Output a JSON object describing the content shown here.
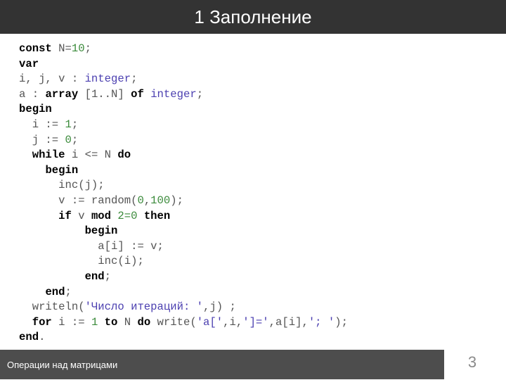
{
  "slide": {
    "title": "1 Заполнение",
    "footer": "Операции над матрицами",
    "page_number": "3"
  },
  "colors": {
    "title_bar": "#333333",
    "footer_bar": "#4d4d4d",
    "keyword": "#000000",
    "number": "#3a8a3a",
    "type_and_string": "#4b3fb0",
    "identifier": "#555555"
  },
  "code": {
    "language": "Pascal",
    "lines": [
      [
        {
          "t": "const",
          "c": "kw"
        },
        {
          "t": " N=",
          "c": ""
        },
        {
          "t": "10",
          "c": "num"
        },
        {
          "t": ";",
          "c": ""
        }
      ],
      [
        {
          "t": "var",
          "c": "kw"
        }
      ],
      [
        {
          "t": "i, j, v : ",
          "c": ""
        },
        {
          "t": "integer",
          "c": "type"
        },
        {
          "t": ";",
          "c": ""
        }
      ],
      [
        {
          "t": "a : ",
          "c": ""
        },
        {
          "t": "array",
          "c": "kw"
        },
        {
          "t": " [1..N] ",
          "c": ""
        },
        {
          "t": "of",
          "c": "kw"
        },
        {
          "t": " ",
          "c": ""
        },
        {
          "t": "integer",
          "c": "type"
        },
        {
          "t": ";",
          "c": ""
        }
      ],
      [
        {
          "t": "begin",
          "c": "kw"
        }
      ],
      [
        {
          "t": "  i := ",
          "c": ""
        },
        {
          "t": "1",
          "c": "num"
        },
        {
          "t": ";",
          "c": ""
        }
      ],
      [
        {
          "t": "  j := ",
          "c": ""
        },
        {
          "t": "0",
          "c": "num"
        },
        {
          "t": ";",
          "c": ""
        }
      ],
      [
        {
          "t": "  ",
          "c": ""
        },
        {
          "t": "while",
          "c": "kw"
        },
        {
          "t": " i <= N ",
          "c": ""
        },
        {
          "t": "do",
          "c": "kw"
        }
      ],
      [
        {
          "t": "    ",
          "c": ""
        },
        {
          "t": "begin",
          "c": "kw"
        }
      ],
      [
        {
          "t": "      inc(j);",
          "c": ""
        }
      ],
      [
        {
          "t": "      v := random(",
          "c": ""
        },
        {
          "t": "0",
          "c": "num"
        },
        {
          "t": ",",
          "c": ""
        },
        {
          "t": "100",
          "c": "num"
        },
        {
          "t": ");",
          "c": ""
        }
      ],
      [
        {
          "t": "      ",
          "c": ""
        },
        {
          "t": "if",
          "c": "kw"
        },
        {
          "t": " v ",
          "c": ""
        },
        {
          "t": "mod",
          "c": "kw"
        },
        {
          "t": " ",
          "c": ""
        },
        {
          "t": "2=0",
          "c": "num"
        },
        {
          "t": " ",
          "c": ""
        },
        {
          "t": "then",
          "c": "kw"
        }
      ],
      [
        {
          "t": "          ",
          "c": ""
        },
        {
          "t": "begin",
          "c": "kw"
        }
      ],
      [
        {
          "t": "            a[i] := v;",
          "c": ""
        }
      ],
      [
        {
          "t": "            inc(i);",
          "c": ""
        }
      ],
      [
        {
          "t": "          ",
          "c": ""
        },
        {
          "t": "end",
          "c": "kw"
        },
        {
          "t": ";",
          "c": ""
        }
      ],
      [
        {
          "t": "    ",
          "c": ""
        },
        {
          "t": "end",
          "c": "kw"
        },
        {
          "t": ";",
          "c": ""
        }
      ],
      [
        {
          "t": "  writeln(",
          "c": ""
        },
        {
          "t": "'Число итераций: '",
          "c": "str"
        },
        {
          "t": ",j) ;",
          "c": ""
        }
      ],
      [
        {
          "t": "  ",
          "c": ""
        },
        {
          "t": "for",
          "c": "kw"
        },
        {
          "t": " i := ",
          "c": ""
        },
        {
          "t": "1",
          "c": "num"
        },
        {
          "t": " ",
          "c": ""
        },
        {
          "t": "to",
          "c": "kw"
        },
        {
          "t": " N ",
          "c": ""
        },
        {
          "t": "do",
          "c": "kw"
        },
        {
          "t": " write(",
          "c": ""
        },
        {
          "t": "'a['",
          "c": "str"
        },
        {
          "t": ",i,",
          "c": ""
        },
        {
          "t": "']='",
          "c": "str"
        },
        {
          "t": ",a[i],",
          "c": ""
        },
        {
          "t": "'; '",
          "c": "str"
        },
        {
          "t": ");",
          "c": ""
        }
      ],
      [
        {
          "t": "end",
          "c": "kw"
        },
        {
          "t": ".",
          "c": ""
        }
      ]
    ]
  }
}
